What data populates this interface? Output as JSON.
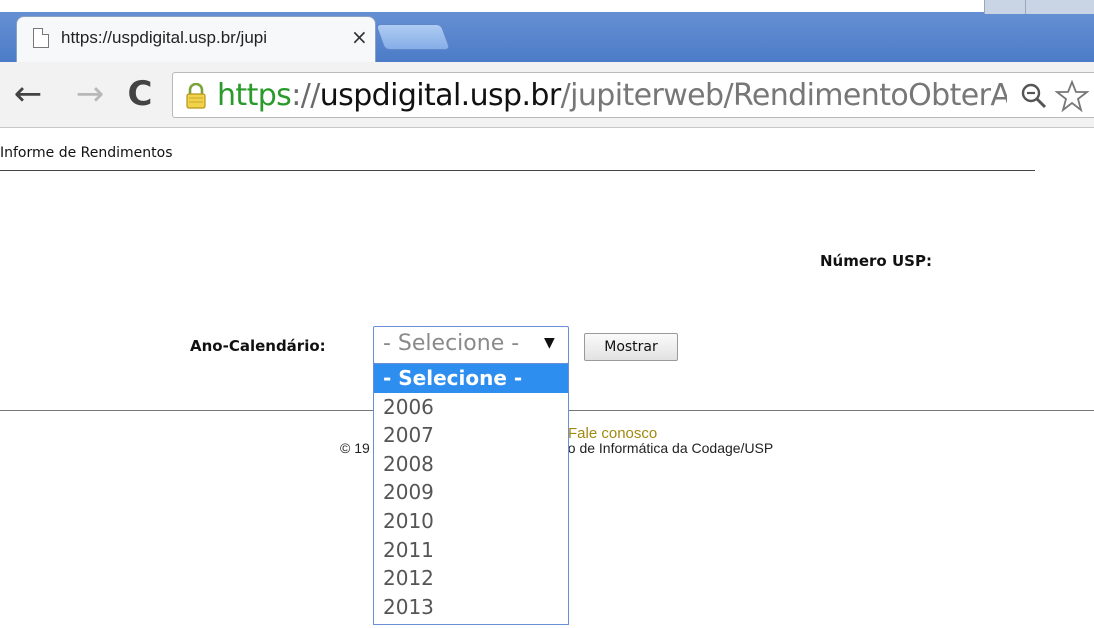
{
  "browser": {
    "tab": {
      "title": "https://uspdigital.usp.br/jupi",
      "close": "×"
    },
    "nav": {
      "back": "←",
      "forward": "→",
      "reload": "C"
    },
    "url": {
      "scheme": "https",
      "separator": "://",
      "host": "uspdigital.usp.br",
      "path": "/jupiterweb/RendimentoObterAnc"
    }
  },
  "page": {
    "title": "Informe de Rendimentos",
    "numero_usp_label": "Número USP:",
    "ano_label": "Ano-Calendário:",
    "select": {
      "value": "- Selecione -",
      "arrow": "▼",
      "options": [
        "- Selecione -",
        "2006",
        "2007",
        "2008",
        "2009",
        "2010",
        "2011",
        "2012",
        "2013"
      ],
      "highlighted": "- Selecione -"
    },
    "mostrar_button": "Mostrar",
    "footer": {
      "link": "Fale conosco",
      "copyright": "© 19",
      "copyright_tail": "o de Informática da Codage/USP"
    }
  },
  "colors": {
    "url_scheme": "#2a9a2a",
    "link": "#a08a10",
    "highlight": "#2e8ef0"
  }
}
